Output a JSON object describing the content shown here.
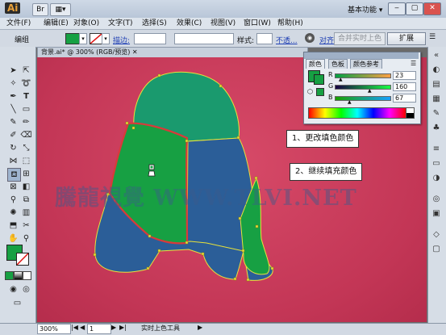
{
  "app": {
    "logo": "Ai",
    "workspace": "基本功能"
  },
  "menu": [
    "文件(F)",
    "编辑(E)",
    "对象(O)",
    "文字(T)",
    "选择(S)",
    "效果(C)",
    "视图(V)",
    "窗口(W)",
    "帮助(H)"
  ],
  "control": {
    "selection_label": "编组",
    "stroke_label": "描边:",
    "style_label": "样式:",
    "opacity_label": "不透...",
    "align_label": "对齐",
    "merge_label": "合并实时上色",
    "expand_label": "扩展"
  },
  "document": {
    "tab_title": "背景.ai* @ 300% (RGB/预览)"
  },
  "color_panel": {
    "tabs": [
      "颜色",
      "色板",
      "颜色参考"
    ],
    "channels": [
      {
        "label": "R",
        "value": "23"
      },
      {
        "label": "G",
        "value": "160"
      },
      {
        "label": "B",
        "value": "67"
      }
    ],
    "fill_color": "#17A043"
  },
  "callouts": [
    "1、更改填色颜色",
    "2、继续填充颜色"
  ],
  "watermark": "騰龍視覺 WWW.TLVI.NET",
  "status": {
    "zoom": "300%",
    "page": "1",
    "tool": "实时上色工具"
  },
  "colors": {
    "canvas": "#C8395A",
    "green": "#17A043",
    "teal": "#1A9A6E",
    "blue": "#2B5E98",
    "selection": "#D93A3A",
    "path": "#E8E23A"
  }
}
